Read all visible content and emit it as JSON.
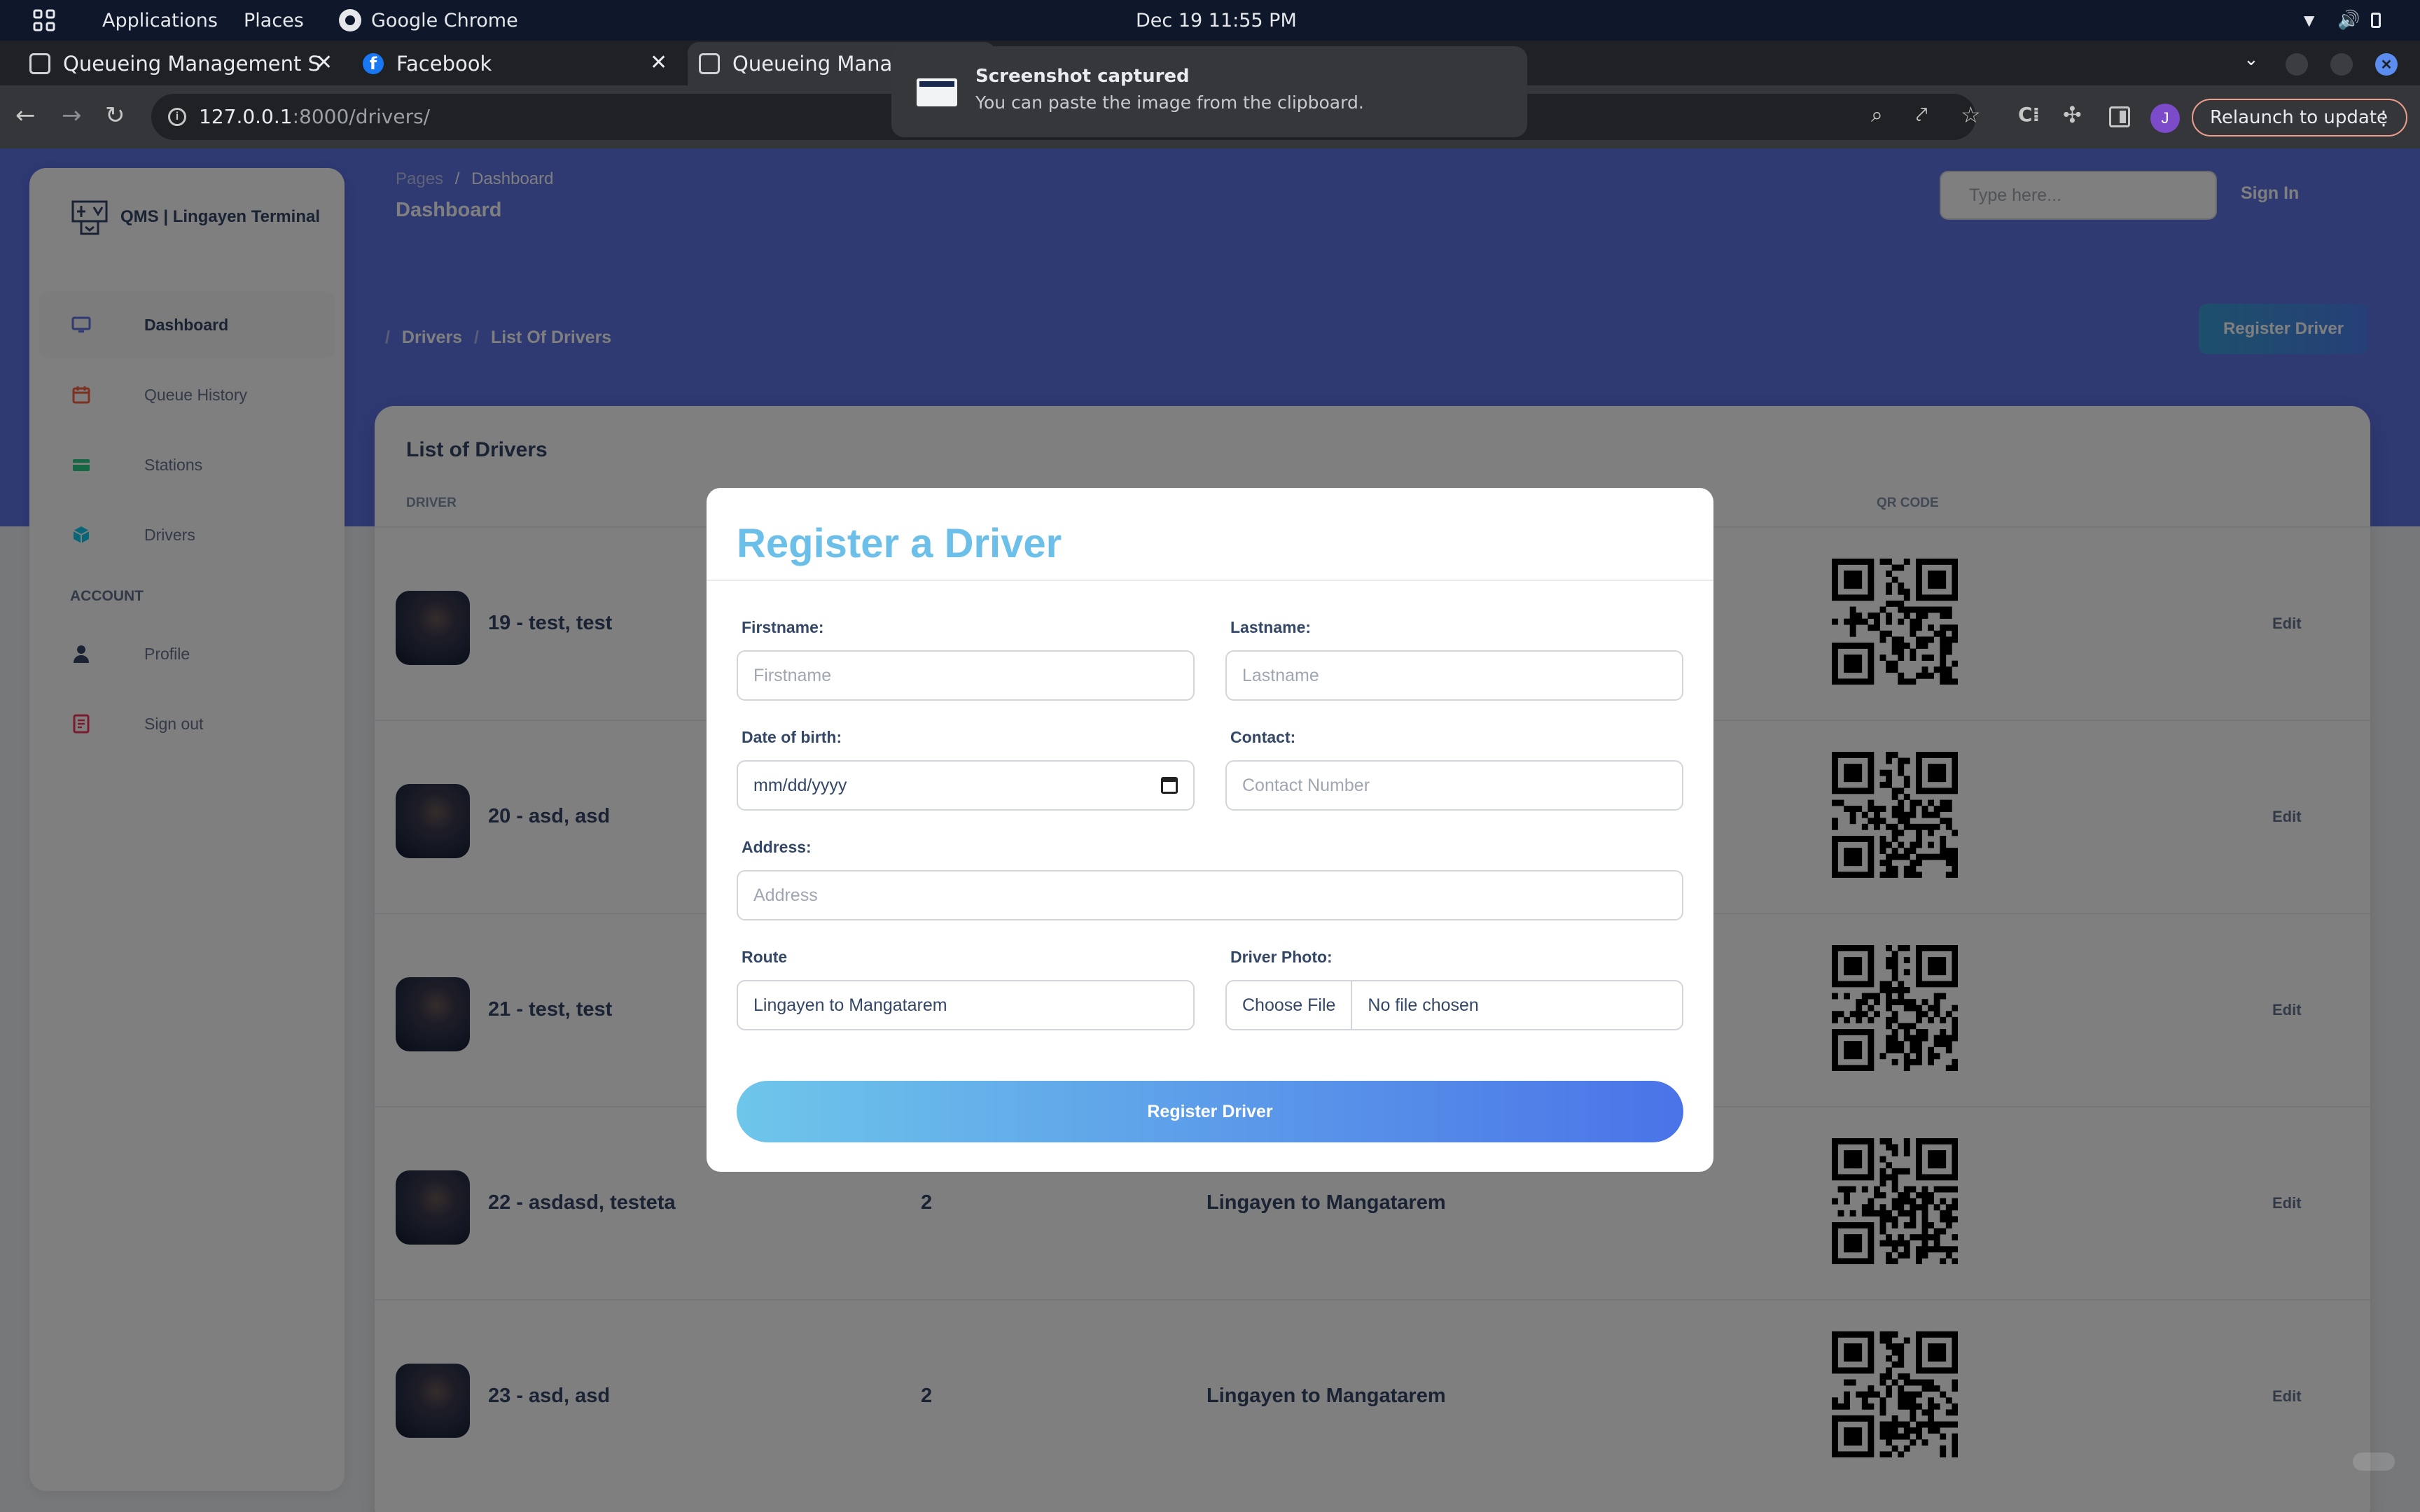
{
  "system_bar": {
    "applications": "Applications",
    "places": "Places",
    "active_app": "Google Chrome",
    "clock": "Dec 19  11:55 PM"
  },
  "browser": {
    "tabs": [
      {
        "label": "Queueing Management S"
      },
      {
        "label": "Facebook"
      },
      {
        "label": "Queueing Manage"
      }
    ],
    "url_host": "127.0.0.1",
    "url_rest": ":8000/drivers/",
    "profile_initial": "J",
    "relaunch_label": "Relaunch to update"
  },
  "notification": {
    "title": "Screenshot captured",
    "body": "You can paste the image from the clipboard."
  },
  "sidebar": {
    "brand": "QMS | Lingayen Terminal",
    "items": [
      {
        "label": "Dashboard",
        "icon": "monitor-icon",
        "active": true
      },
      {
        "label": "Queue History",
        "icon": "calendar-icon"
      },
      {
        "label": "Stations",
        "icon": "credit-card-icon"
      },
      {
        "label": "Drivers",
        "icon": "cube-icon"
      }
    ],
    "section": "ACCOUNT",
    "account_items": [
      {
        "label": "Profile",
        "icon": "user-icon"
      },
      {
        "label": "Sign out",
        "icon": "document-icon"
      }
    ]
  },
  "header": {
    "crumb_root": "Pages",
    "crumb_current": "Dashboard",
    "page_title": "Dashboard",
    "search_placeholder": "Type here...",
    "sign_in": "Sign In"
  },
  "subheader": {
    "crumb_root": "Drivers",
    "crumb_current": "List Of Drivers",
    "register_button": "Register Driver"
  },
  "table": {
    "title": "List of Drivers",
    "columns": {
      "driver": "DRIVER",
      "qr": "QR CODE"
    },
    "rows": [
      {
        "name": "19 - test, test",
        "number": "",
        "route": "",
        "action": "Edit"
      },
      {
        "name": "20 - asd, asd",
        "number": "",
        "route": "",
        "action": "Edit"
      },
      {
        "name": "21 - test, test",
        "number": "",
        "route": "",
        "action": "Edit"
      },
      {
        "name": "22 - asdasd, testeta",
        "number": "2",
        "route": "Lingayen to Mangatarem",
        "action": "Edit"
      },
      {
        "name": "23 - asd, asd",
        "number": "2",
        "route": "Lingayen to Mangatarem",
        "action": "Edit"
      }
    ]
  },
  "modal": {
    "title": "Register a Driver",
    "firstname_label": "Firstname:",
    "firstname_placeholder": "Firstname",
    "lastname_label": "Lastname:",
    "lastname_placeholder": "Lastname",
    "dob_label": "Date of birth:",
    "dob_placeholder": "mm/dd/yyyy",
    "contact_label": "Contact:",
    "contact_placeholder": "Contact Number",
    "address_label": "Address:",
    "address_placeholder": "Address",
    "route_label": "Route",
    "route_value": "Lingayen to Mangatarem",
    "photo_label": "Driver Photo:",
    "choose_file": "Choose File",
    "no_file": "No file chosen",
    "submit": "Register Driver"
  }
}
